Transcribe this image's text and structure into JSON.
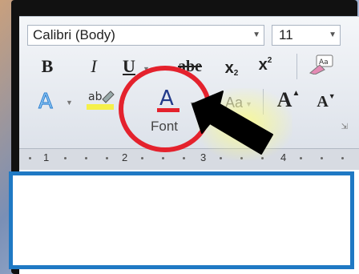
{
  "font_group": {
    "font_name": "Calibri (Body)",
    "font_size": "11",
    "label": "Font"
  },
  "buttons": {
    "bold": "B",
    "italic": "I",
    "underline": "U",
    "strike": "abe",
    "subscript": "x",
    "superscript": "x",
    "highlight": "ab",
    "font_color": "A",
    "grow": "A",
    "shrink": "A",
    "clear_format": "Aa"
  },
  "ruler": {
    "marks": [
      "1",
      "2",
      "3",
      "4"
    ]
  },
  "annotation": {
    "circle_color": "#e4222d",
    "arrow_color": "#000000",
    "highlight_border": "#1f79c4"
  }
}
